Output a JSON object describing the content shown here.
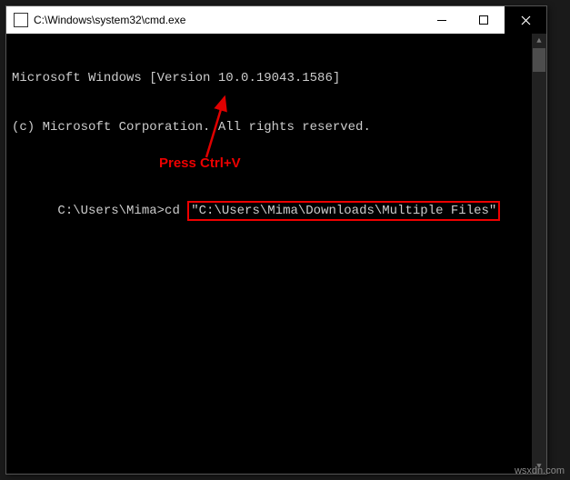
{
  "titlebar": {
    "icon_text": "C:\\",
    "title": "C:\\Windows\\system32\\cmd.exe"
  },
  "terminal": {
    "line1": "Microsoft Windows [Version 10.0.19043.1586]",
    "line2": "(c) Microsoft Corporation. All rights reserved.",
    "prompt": "C:\\Users\\Mima>cd",
    "highlighted_command": "\"C:\\Users\\Mima\\Downloads\\Multiple Files\""
  },
  "annotation": {
    "label": "Press Ctrl+V",
    "arrow_color": "#e00000"
  },
  "watermark": "wsxdn.com"
}
